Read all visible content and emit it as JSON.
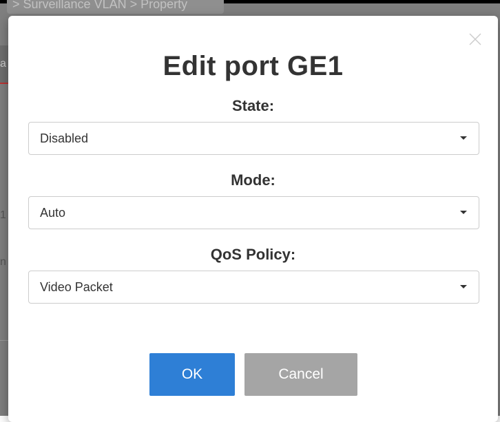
{
  "background": {
    "breadcrumb": "> Surveillance VLAN  >  Property",
    "left_fragments": [
      "a",
      "1",
      "n"
    ]
  },
  "dialog": {
    "title": "Edit port GE1",
    "close_icon": "close-icon",
    "fields": [
      {
        "label": "State:",
        "value": "Disabled"
      },
      {
        "label": "Mode:",
        "value": "Auto"
      },
      {
        "label": "QoS Policy:",
        "value": "Video Packet"
      }
    ],
    "ok_label": "OK",
    "cancel_label": "Cancel"
  },
  "colors": {
    "ok_button": "#2e7fd6",
    "cancel_button": "#a5a5a5",
    "overlay": "#7f7f7f"
  }
}
